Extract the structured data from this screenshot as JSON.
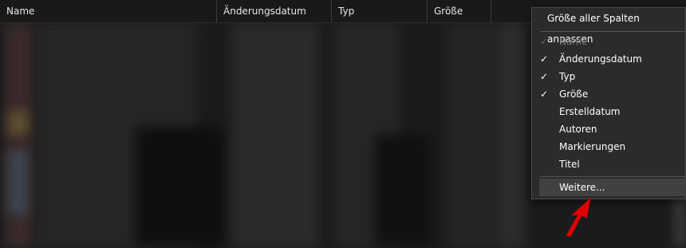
{
  "columns": [
    {
      "label": "Name"
    },
    {
      "label": "Änderungsdatum"
    },
    {
      "label": "Typ"
    },
    {
      "label": "Größe"
    }
  ],
  "context_menu": {
    "top_item": "Größe aller Spalten anpassen",
    "items": [
      {
        "label": "Name",
        "checked": true,
        "disabled": true
      },
      {
        "label": "Änderungsdatum",
        "checked": true,
        "disabled": false
      },
      {
        "label": "Typ",
        "checked": true,
        "disabled": false
      },
      {
        "label": "Größe",
        "checked": true,
        "disabled": false
      },
      {
        "label": "Erstelldatum",
        "checked": false,
        "disabled": false
      },
      {
        "label": "Autoren",
        "checked": false,
        "disabled": false
      },
      {
        "label": "Markierungen",
        "checked": false,
        "disabled": false
      },
      {
        "label": "Titel",
        "checked": false,
        "disabled": false
      }
    ],
    "more_item": "Weitere...",
    "check_glyph": "✓"
  },
  "colors": {
    "background": "#191919",
    "menu_bg": "#2b2b2b",
    "annotation_arrow": "#e00000"
  }
}
